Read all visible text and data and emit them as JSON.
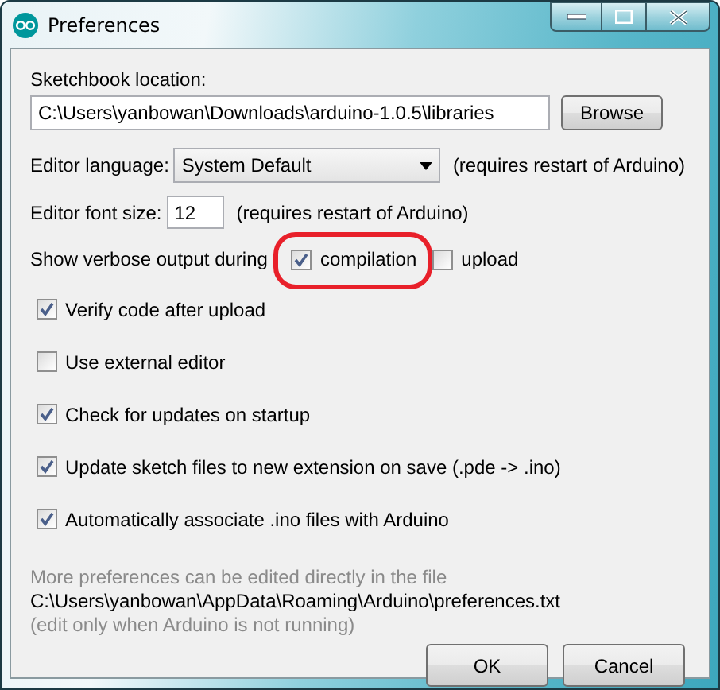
{
  "window": {
    "title": "Preferences"
  },
  "sketchbook": {
    "label": "Sketchbook location:",
    "value": "C:\\Users\\yanbowan\\Downloads\\arduino-1.0.5\\libraries",
    "button": "Browse"
  },
  "language": {
    "label": "Editor language:",
    "value": "System Default",
    "note": "(requires restart of Arduino)"
  },
  "font_size": {
    "label": "Editor font size:",
    "value": "12",
    "note": "(requires restart of Arduino)"
  },
  "verbose": {
    "label": "Show verbose output during",
    "options": [
      {
        "label": "compilation",
        "checked": true,
        "highlighted": true
      },
      {
        "label": "upload",
        "checked": false,
        "highlighted": false
      }
    ]
  },
  "options": [
    {
      "label": "Verify code after upload",
      "checked": true
    },
    {
      "label": "Use external editor",
      "checked": false
    },
    {
      "label": "Check for updates on startup",
      "checked": true
    },
    {
      "label": "Update sketch files to new extension on save (.pde -> .ino)",
      "checked": true
    },
    {
      "label": "Automatically associate .ino files with Arduino",
      "checked": true
    }
  ],
  "footer": {
    "note": "More preferences can be edited directly in the file",
    "path": "C:\\Users\\yanbowan\\AppData\\Roaming\\Arduino\\preferences.txt",
    "hint": "(edit only when Arduino is not running)"
  },
  "buttons": [
    "OK",
    "Cancel"
  ]
}
